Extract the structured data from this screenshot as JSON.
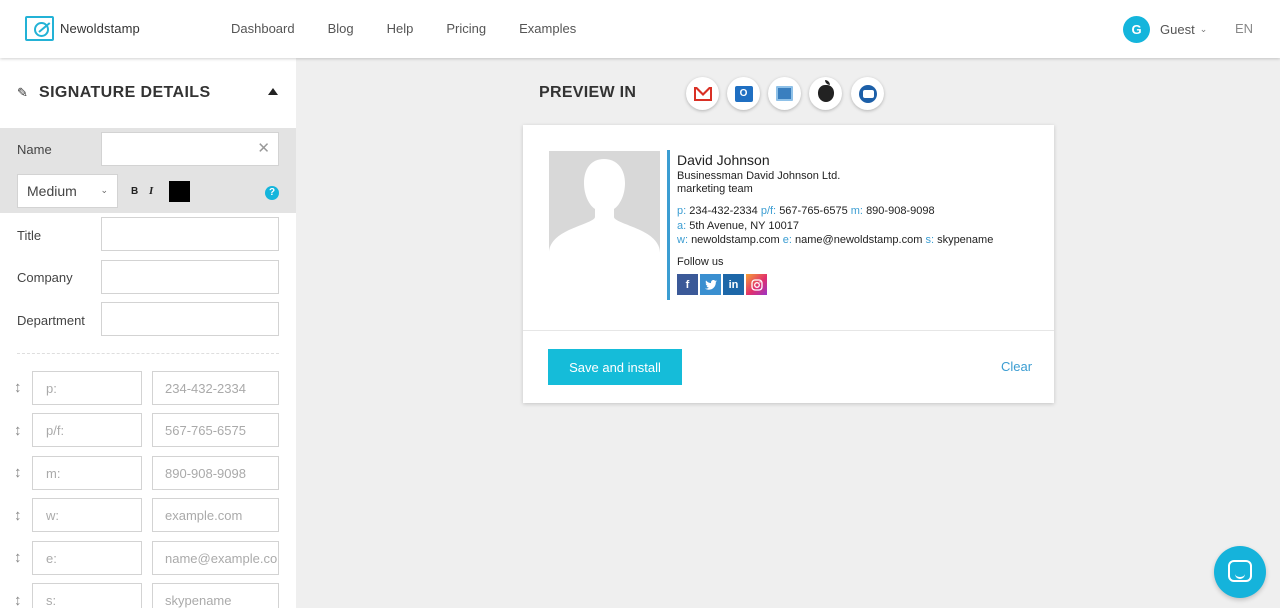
{
  "brand": {
    "name": "Newoldstamp"
  },
  "nav": [
    "Dashboard",
    "Blog",
    "Help",
    "Pricing",
    "Examples"
  ],
  "user": {
    "initial": "G",
    "name": "Guest",
    "lang": "EN"
  },
  "sidebar": {
    "title": "SIGNATURE DETAILS",
    "name_label": "Name",
    "font_weight": "Medium",
    "bold_label": "B",
    "italic_label": "I",
    "help_label": "?",
    "text_color": "#000000",
    "title_label": "Title",
    "company_label": "Company",
    "department_label": "Department",
    "contacts": [
      {
        "key": "p:",
        "value": "234-432-2334"
      },
      {
        "key": "p/f:",
        "value": "567-765-6575"
      },
      {
        "key": "m:",
        "value": "890-908-9098"
      },
      {
        "key": "w:",
        "value": "example.com"
      },
      {
        "key": "e:",
        "value": "name@example.co"
      },
      {
        "key": "s:",
        "value": "skypename"
      }
    ]
  },
  "preview": {
    "label": "PREVIEW IN",
    "clients": [
      "gmail-icon",
      "outlook-icon",
      "apple-mail-icon",
      "apple-icon",
      "thunderbird-icon"
    ]
  },
  "signature": {
    "name": "David Johnson",
    "title": "Businessman David Johnson Ltd.",
    "department": "marketing team",
    "phone_key": "p:",
    "phone": "234-432-2334",
    "fax_key": "p/f:",
    "fax": "567-765-6575",
    "mobile_key": "m:",
    "mobile": "890-908-9098",
    "address_key": "a:",
    "address": "5th Avenue, NY 10017",
    "web_key": "w:",
    "web": "newoldstamp.com",
    "email_key": "e:",
    "email": "name@newoldstamp.com",
    "skype_key": "s:",
    "skype": "skypename",
    "follow_label": "Follow us",
    "socials": {
      "facebook": "f",
      "twitter": "",
      "linkedin": "in",
      "instagram": ""
    }
  },
  "actions": {
    "save_label": "Save and install",
    "clear_label": "Clear"
  },
  "colors": {
    "accent": "#15bcd9",
    "link": "#3b9dd2"
  }
}
